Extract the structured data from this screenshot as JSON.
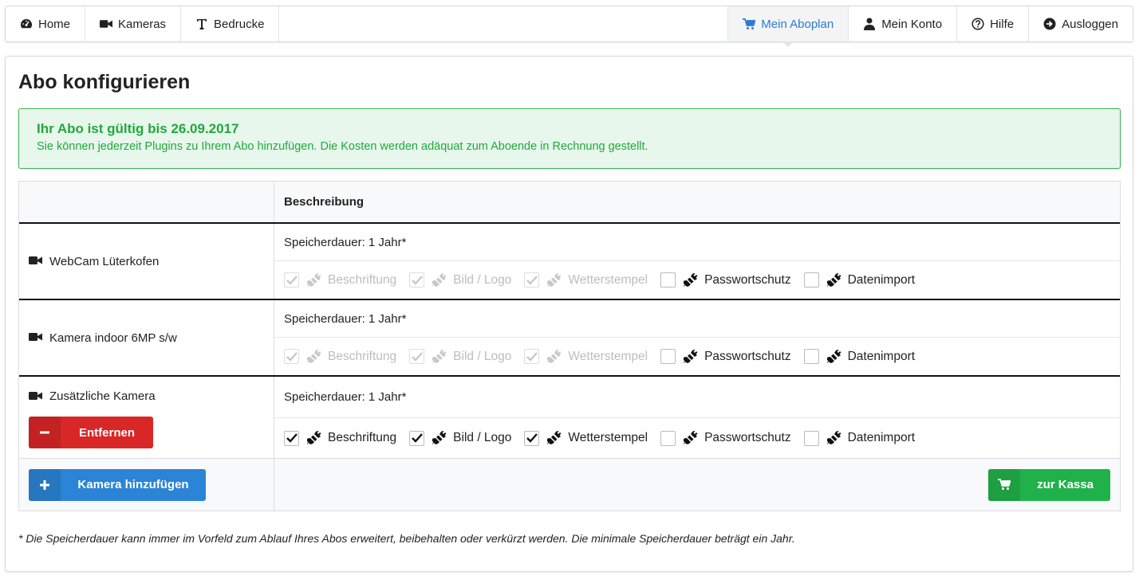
{
  "nav": {
    "left": [
      {
        "label": "Home",
        "icon": "dashboard-icon"
      },
      {
        "label": "Kameras",
        "icon": "video-camera-icon"
      },
      {
        "label": "Bedrucke",
        "icon": "text-icon"
      }
    ],
    "right": [
      {
        "label": "Mein Aboplan",
        "icon": "cart-icon",
        "active": true
      },
      {
        "label": "Mein Konto",
        "icon": "user-icon"
      },
      {
        "label": "Hilfe",
        "icon": "help-icon"
      },
      {
        "label": "Ausloggen",
        "icon": "logout-icon"
      }
    ]
  },
  "page": {
    "title": "Abo konfigurieren"
  },
  "alert": {
    "title": "Ihr Abo ist gültig bis 26.09.2017",
    "text": "Sie können jederzeit Plugins zu Ihrem Abo hinzufügen. Die Kosten werden adäquat zum Aboende in Rechnung gestellt."
  },
  "table": {
    "col_header": "Beschreibung",
    "storage_label": "Speicherdauer: 1 Jahr*",
    "plugins": [
      "Beschriftung",
      "Bild / Logo",
      "Wetterstempel",
      "Passwortschutz",
      "Datenimport"
    ],
    "cameras": [
      {
        "name": "WebCam Lüterkofen",
        "states": [
          "disabled-checked",
          "disabled-checked",
          "disabled-checked",
          "unchecked",
          "unchecked"
        ]
      },
      {
        "name": "Kamera indoor 6MP s/w",
        "states": [
          "disabled-checked",
          "disabled-checked",
          "disabled-checked",
          "unchecked",
          "unchecked"
        ]
      },
      {
        "name": "Zusätzliche Kamera",
        "states": [
          "checked",
          "checked",
          "checked",
          "unchecked",
          "unchecked"
        ],
        "remove_label": "Entfernen"
      }
    ],
    "add_camera_label": "Kamera hinzufügen",
    "checkout_label": "zur Kassa"
  },
  "footnote": "* Die Speicherdauer kann immer im Vorfeld zum Ablauf Ihres Abos erweitert, beibehalten oder verkürzt werden. Die minimale Speicherdauer beträgt ein Jahr.",
  "colors": {
    "accent": "#2b7cd3",
    "success": "#21b14a",
    "danger": "#d92626",
    "alert_bg": "#e7f7ec"
  }
}
